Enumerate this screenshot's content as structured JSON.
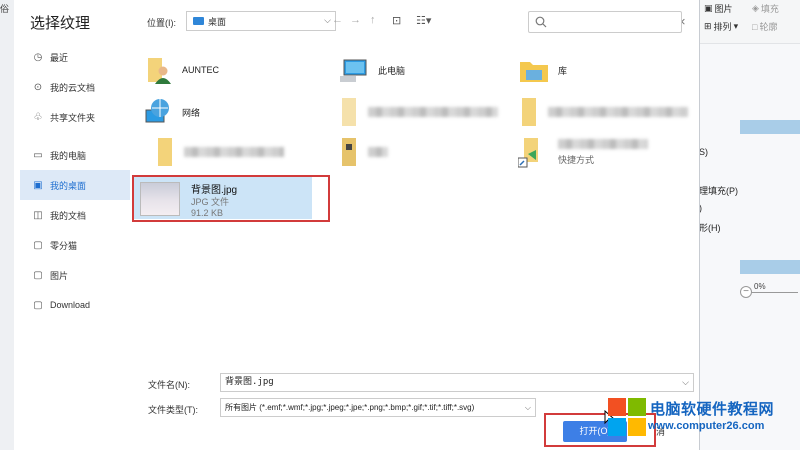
{
  "dialog": {
    "title": "选择纹理",
    "close": "×"
  },
  "nav": {
    "location_label": "位置(I):",
    "location_value": "桌面",
    "back": "←",
    "forward": "→",
    "up": "↑",
    "search_placeholder": ""
  },
  "sidebar": {
    "items": [
      {
        "label": "最近",
        "icon": "clock-icon"
      },
      {
        "label": "我的云文档",
        "icon": "cloud-doc-icon"
      },
      {
        "label": "共享文件夹",
        "icon": "share-icon"
      },
      {
        "label": "我的电脑",
        "icon": "computer-icon"
      },
      {
        "label": "我的桌面",
        "icon": "desktop-icon",
        "active": true
      },
      {
        "label": "我的文档",
        "icon": "documents-icon"
      },
      {
        "label": "零分猫",
        "icon": "folder-icon"
      },
      {
        "label": "图片",
        "icon": "folder-icon"
      },
      {
        "label": "Download",
        "icon": "folder-icon"
      }
    ]
  },
  "files": {
    "auntec": "AUNTEC",
    "this_pc": "此电脑",
    "library": "库",
    "network": "网络",
    "shortcut": "快捷方式",
    "selected": {
      "name": "背景图.jpg",
      "type": "JPG 文件",
      "size": "91.2 KB"
    }
  },
  "bottom": {
    "filename_label": "文件名(N):",
    "filename_value": "背景图.jpg",
    "filetype_label": "文件类型(T):",
    "filetype_value": "所有图片 (*.emf;*.wmf;*.jpg;*.jpeg;*.jpe;*.png;*.bmp;*.gif;*.tif;*.tiff;*.svg)",
    "open_button": "打开(O)",
    "cancel_partial": "消"
  },
  "background_app": {
    "left_label": "俗",
    "toolbar": {
      "picture": "图片",
      "fill": "填充",
      "arrange": "排列",
      "outline": "轮廓"
    },
    "menu": [
      "S(S)",
      "纹理填充(P)",
      "(A)",
      "图形(H)"
    ],
    "percent": "0%"
  },
  "watermark": {
    "line1": "电脑软硬件教程网",
    "line2": "www.computer26.com"
  },
  "colors": {
    "accent": "#3d7fe6",
    "highlight": "#d23b3b",
    "selection": "#cce4f7"
  }
}
